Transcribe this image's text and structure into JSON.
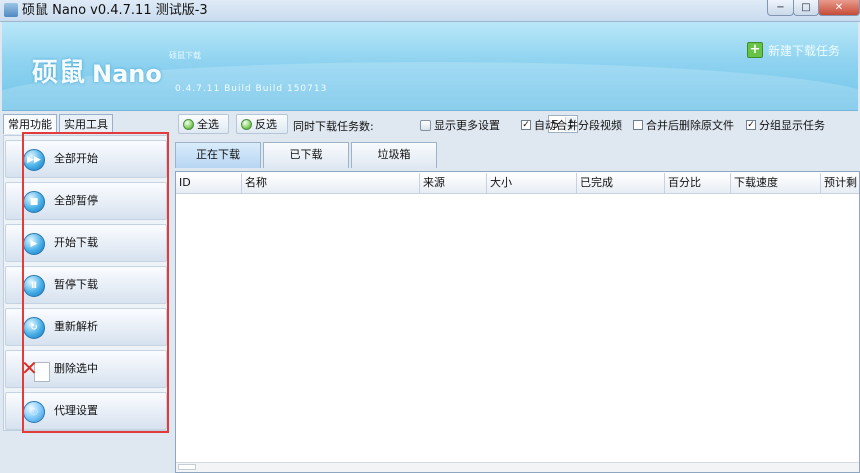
{
  "window": {
    "title": "硕鼠 Nano v0.4.7.11 测试版-3",
    "icons": {
      "app": "app-icon",
      "minimize": "minimize-icon",
      "maximize": "maximize-icon",
      "close": "close-icon"
    },
    "glyphs": {
      "minimize": "−",
      "maximize": "□",
      "close": "✕"
    }
  },
  "banner": {
    "logo_cn": "硕鼠",
    "logo_en": "Nano",
    "small_text": "硕鼠下载",
    "version_text": "0.4.7.11 Build Build 150713",
    "new_task_label": "新建下载任务",
    "new_task_glyph": "+"
  },
  "left_tabs": [
    {
      "label": "常用功能"
    },
    {
      "label": "实用工具"
    }
  ],
  "sidebar_items": [
    {
      "label": "全部开始",
      "icon": "start-all-icon",
      "glyph": "▶▶"
    },
    {
      "label": "全部暂停",
      "icon": "pause-all-icon",
      "glyph": "■"
    },
    {
      "label": "开始下载",
      "icon": "start-icon",
      "glyph": "▶"
    },
    {
      "label": "暂停下载",
      "icon": "pause-icon",
      "glyph": "Ⅱ"
    },
    {
      "label": "重新解析",
      "icon": "refresh-icon",
      "glyph": "↻"
    },
    {
      "label": "删除选中",
      "icon": "delete-icon",
      "glyph": "✕"
    },
    {
      "label": "代理设置",
      "icon": "proxy-icon",
      "glyph": "◌"
    }
  ],
  "toolbar": {
    "select_all": "全选",
    "invert_selection": "反选",
    "simultaneous_label": "同时下载任务数:",
    "simultaneous_value": "5",
    "show_more_settings": "显示更多设置",
    "auto_merge": "自动合并分段视频",
    "delete_after_merge": "合并后删除原文件",
    "group_tasks": "分组显示任务",
    "checked_glyph": "✓"
  },
  "tabs": [
    {
      "label": "正在下载",
      "active": true
    },
    {
      "label": "已下载",
      "active": false
    },
    {
      "label": "垃圾箱",
      "active": false
    }
  ],
  "table": {
    "columns": [
      "ID",
      "名称",
      "来源",
      "大小",
      "已完成",
      "百分比",
      "下载速度",
      "预计剩"
    ]
  },
  "colors": {
    "highlight_red": "#e33a3a",
    "banner_blue": "#8fd3f0",
    "button_blue": "#49b0e9"
  }
}
